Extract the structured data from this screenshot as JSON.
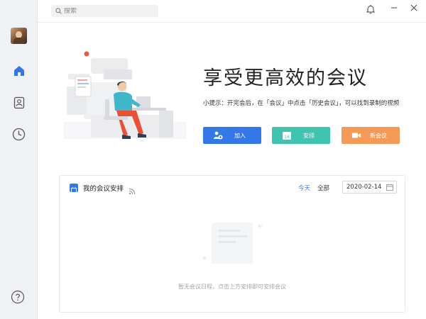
{
  "search": {
    "placeholder": "搜索"
  },
  "hero": {
    "title": "享受更高效的会议",
    "tip": "小提示：开完会后，在「会议」中点击「历史会议」，可以找到录制的视频"
  },
  "actions": {
    "join": "加入",
    "schedule": "安排",
    "new_meeting": "新会议",
    "schedule_icon_text": "16"
  },
  "panel": {
    "title": "我的会议安排",
    "today": "今天",
    "all": "全部",
    "date": "2020-02-14",
    "empty": "暂无会议日程，点击上方安排即可安排会议"
  },
  "colors": {
    "primary": "#3478e8",
    "teal": "#40c4b0",
    "orange": "#f59a56"
  }
}
